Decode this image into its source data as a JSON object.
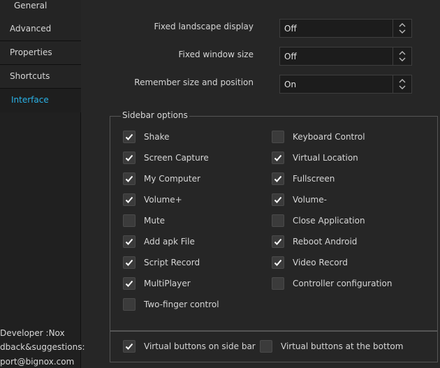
{
  "nav": {
    "items": [
      {
        "label": "General",
        "active": false
      },
      {
        "label": "Advanced",
        "active": false
      },
      {
        "label": "Properties",
        "active": false
      },
      {
        "label": "Shortcuts",
        "active": false
      },
      {
        "label": "Interface",
        "active": true
      }
    ],
    "active_color": "#2ab3e8"
  },
  "footer": {
    "developer": "Developer :Nox",
    "feedback": "dback&suggestions:",
    "email": "port@bignox.com"
  },
  "settings": [
    {
      "label": "Fixed landscape display",
      "value": "Off"
    },
    {
      "label": "Fixed window size",
      "value": "Off"
    },
    {
      "label": "Remember size and position",
      "value": "On"
    }
  ],
  "sidebar_options": {
    "title": "Sidebar options",
    "left": [
      {
        "label": "Shake",
        "checked": true
      },
      {
        "label": "Screen Capture",
        "checked": true
      },
      {
        "label": "My Computer",
        "checked": true
      },
      {
        "label": "Volume+",
        "checked": true
      },
      {
        "label": "Mute",
        "checked": false
      },
      {
        "label": "Add apk File",
        "checked": true
      },
      {
        "label": "Script Record",
        "checked": true
      },
      {
        "label": "MultiPlayer",
        "checked": true
      },
      {
        "label": "Two-finger control",
        "checked": false
      }
    ],
    "right": [
      {
        "label": "Keyboard Control",
        "checked": false
      },
      {
        "label": "Virtual Location",
        "checked": true
      },
      {
        "label": "Fullscreen",
        "checked": true
      },
      {
        "label": "Volume-",
        "checked": true
      },
      {
        "label": "Close Application",
        "checked": false
      },
      {
        "label": "Reboot Android",
        "checked": true
      },
      {
        "label": "Video Record",
        "checked": true
      },
      {
        "label": "Controller configuration",
        "checked": false
      }
    ]
  },
  "virtual_buttons": [
    {
      "label": "Virtual buttons on side bar",
      "checked": true
    },
    {
      "label": "Virtual buttons at the bottom",
      "checked": false
    }
  ]
}
